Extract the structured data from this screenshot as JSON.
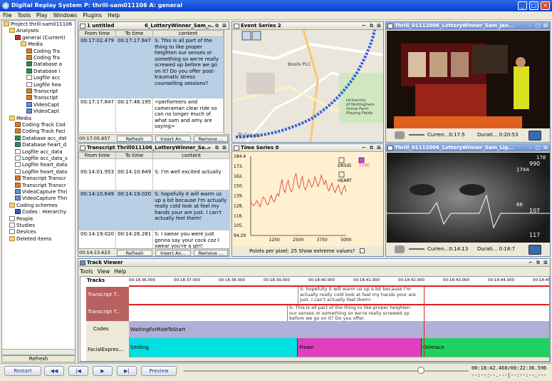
{
  "window": {
    "title": "Digital Replay System P: thrill-sam011106 A: general"
  },
  "menu": [
    "File",
    "Tools",
    "Play",
    "Windows",
    "Plugins",
    "Help"
  ],
  "tree": {
    "items": [
      {
        "label": "Project thrill-sam011106",
        "icon": "folder"
      },
      {
        "label": "Analyses",
        "icon": "folder"
      },
      {
        "label": "general (Current)",
        "icon": "red"
      },
      {
        "label": "Media",
        "icon": "folder"
      },
      {
        "label": "Coding Tra",
        "icon": "trans"
      },
      {
        "label": "Coding Tra",
        "icon": "trans"
      },
      {
        "label": "Database a",
        "icon": "db"
      },
      {
        "label": "Database i",
        "icon": "db"
      },
      {
        "label": "Logfile acc",
        "icon": "doc"
      },
      {
        "label": "Logfile hea",
        "icon": "doc"
      },
      {
        "label": "Transcript",
        "icon": "trans"
      },
      {
        "label": "Transcript",
        "icon": "trans"
      },
      {
        "label": "VideoCapt",
        "icon": "vid"
      },
      {
        "label": "VideoCapt",
        "icon": "vid"
      },
      {
        "label": "Media",
        "icon": "folder"
      },
      {
        "label": "Coding Track Cod",
        "icon": "trans"
      },
      {
        "label": "Coding Track Faci",
        "icon": "trans"
      },
      {
        "label": "Database acc_dat",
        "icon": "db"
      },
      {
        "label": "Database heart_d",
        "icon": "db"
      },
      {
        "label": "Logfile acc_data",
        "icon": "doc"
      },
      {
        "label": "Logfile acc_data_s",
        "icon": "doc"
      },
      {
        "label": "Logfile heart_data",
        "icon": "doc"
      },
      {
        "label": "Logfile heart_data",
        "icon": "doc"
      },
      {
        "label": "Transcript Transcr",
        "icon": "trans"
      },
      {
        "label": "Transcript Transcr",
        "icon": "trans"
      },
      {
        "label": "VideoCapture Thri",
        "icon": "vid"
      },
      {
        "label": "VideoCapture Thri",
        "icon": "vid"
      },
      {
        "label": "Coding schemes",
        "icon": "folder"
      },
      {
        "label": "Codes : Hierarchy",
        "icon": "code"
      },
      {
        "label": "People",
        "icon": "doc"
      },
      {
        "label": "Studies",
        "icon": "doc"
      },
      {
        "label": "Devices",
        "icon": "doc"
      },
      {
        "label": "Deleted items",
        "icon": "folder"
      }
    ],
    "refresh": "Refresh"
  },
  "untitled": {
    "title": "1 untitled",
    "subtitle": "6_LotteryWinner_Sam_...",
    "headers": [
      "From time",
      "To time",
      "content"
    ],
    "rows": [
      {
        "from": "00:17:02.479",
        "to": "00:17:17.847",
        "content": "S: This is all part of the thing to like proper heighten our senses or something so we're really screwed up before we go on it? Do you offer post-traumatic stress counselling sessions?",
        "sel": true
      },
      {
        "from": "00:17:17.847",
        "to": "00:17:48.195",
        "content": "<performers and cameraman clear ride so can no longer much of what sam and amy are saying>",
        "sel": false
      }
    ],
    "footer_time": "00:17:05.657",
    "buttons": [
      "Refresh",
      "Insert An...",
      "Remove ..."
    ]
  },
  "transcript": {
    "title": "Transcript Thrill011106_LotteryWinner_Sa...",
    "headers": [
      "From time",
      "To time",
      "content"
    ],
    "rows": [
      {
        "from": "00:14:01.953",
        "to": "00:14:10.649",
        "content": "S: I'm well excited actually",
        "sel": false
      },
      {
        "from": "00:14:10.649",
        "to": "00:14:19.020",
        "content": "S: hopefully it will warm us up a bit because I'm actually really cold look at feel my hands your are just. I can't actually feel them!",
        "sel": true
      },
      {
        "from": "00:14:19.020",
        "to": "00:14:26.281",
        "content": "S: I swear you were just gonna say your cock coz I swear you're a girl!",
        "sel": false
      }
    ],
    "footer_time": "00:14:13.623",
    "buttons": [
      "Refresh",
      "Insert An...",
      "Remove ..."
    ]
  },
  "event_series": {
    "title": "Event Series 2",
    "map_labels": [
      "Boots PLC",
      "University of Nottingham Grove Farm Playing Fields",
      "Rylands"
    ]
  },
  "time_series": {
    "title": "Time Series 0",
    "footer": "Points per pixel:  25  Show extreme values?",
    "legend": [
      "DRSID",
      "TYPE",
      "HEART"
    ],
    "chart_data": {
      "type": "line",
      "x_ticks": [
        "1250",
        "2500",
        "3750",
        "5000"
      ],
      "y_ticks": [
        "184.4",
        "173.",
        "162.",
        "150.",
        "139.",
        "128.",
        "116.",
        "105.",
        "94.29"
      ],
      "ylim": [
        94.29,
        184.4
      ],
      "xlim": [
        0,
        5000
      ],
      "series": [
        {
          "name": "HEART",
          "values": [
            132,
            130,
            128,
            131,
            134,
            130,
            127,
            133,
            138,
            136,
            131,
            129,
            134,
            140,
            135,
            132,
            137,
            142,
            139,
            150,
            158,
            146,
            143,
            152,
            157,
            147,
            144,
            149,
            160,
            165,
            152,
            148,
            155,
            162,
            150,
            146,
            151,
            158,
            154,
            149,
            153,
            161,
            156,
            150,
            155,
            163,
            158,
            152,
            157,
            149,
            145,
            150,
            154,
            147,
            143,
            148,
            152,
            145,
            141,
            147,
            151,
            144
          ]
        }
      ]
    }
  },
  "video1": {
    "title": "Thrill_01112006_LotteryWinner_Sam_Jan...",
    "current_label": "Curren...0:17:5",
    "duration_label": "Durati... 0:20:53"
  },
  "video2": {
    "title": "Thrill_01112006_LotteryWinner_Sam_Lig...",
    "current_label": "Curren...0:14:13",
    "duration_label": "Durati... 0:18:7",
    "overlay_numbers": [
      "178",
      "990",
      "1744",
      "66",
      "107",
      "117"
    ]
  },
  "track_viewer": {
    "title": "Track Viewer",
    "menu": [
      "Tools",
      "View",
      "Help"
    ],
    "tracks_label": "Tracks",
    "time_ticks": [
      "00:18:36.000",
      "00:18:37.000",
      "00:18:38.000",
      "00:18:39.000",
      "00:18:40.000",
      "00:18:41.000",
      "00:18:42.000",
      "00:18:43.000",
      "00:18:44.000",
      "00:18:45.0"
    ],
    "rows": [
      {
        "label": "Transcript T...",
        "texts": [
          "S: hopefully it will warm us up a bit because I'm actually really cold look at feel my hands your are just. I can't actually feel them!"
        ]
      },
      {
        "label": "Transcript T...",
        "texts": [
          "S: This is all part of the thing to like proper heighten our senses or something so we're really screwed up before we go on it? Do you offer."
        ]
      },
      {
        "label": "Codes",
        "texts": [
          "WaitingForRideToStart"
        ]
      },
      {
        "label": "FacialExpres...",
        "texts": [
          "Smiling",
          "Frown",
          "Grimace"
        ]
      }
    ]
  },
  "transport": {
    "buttons": [
      "Restart",
      "",
      "",
      "",
      "",
      "Preview"
    ],
    "time_current": "00:18:42.460",
    "time_total": "00:22:36.596",
    "time_placeholder": "--:--:--.---"
  },
  "colors": {
    "titlebar": "#0a3fc8",
    "selected_row": "#b8cfe8",
    "smiling": "#00e0e0",
    "frown": "#e040c0",
    "grimace": "#20d060",
    "codes": "#b0b0d8",
    "transcript_label": "#b86060",
    "chart_bg": "#fff0d0",
    "chart_line": "#e03030"
  }
}
